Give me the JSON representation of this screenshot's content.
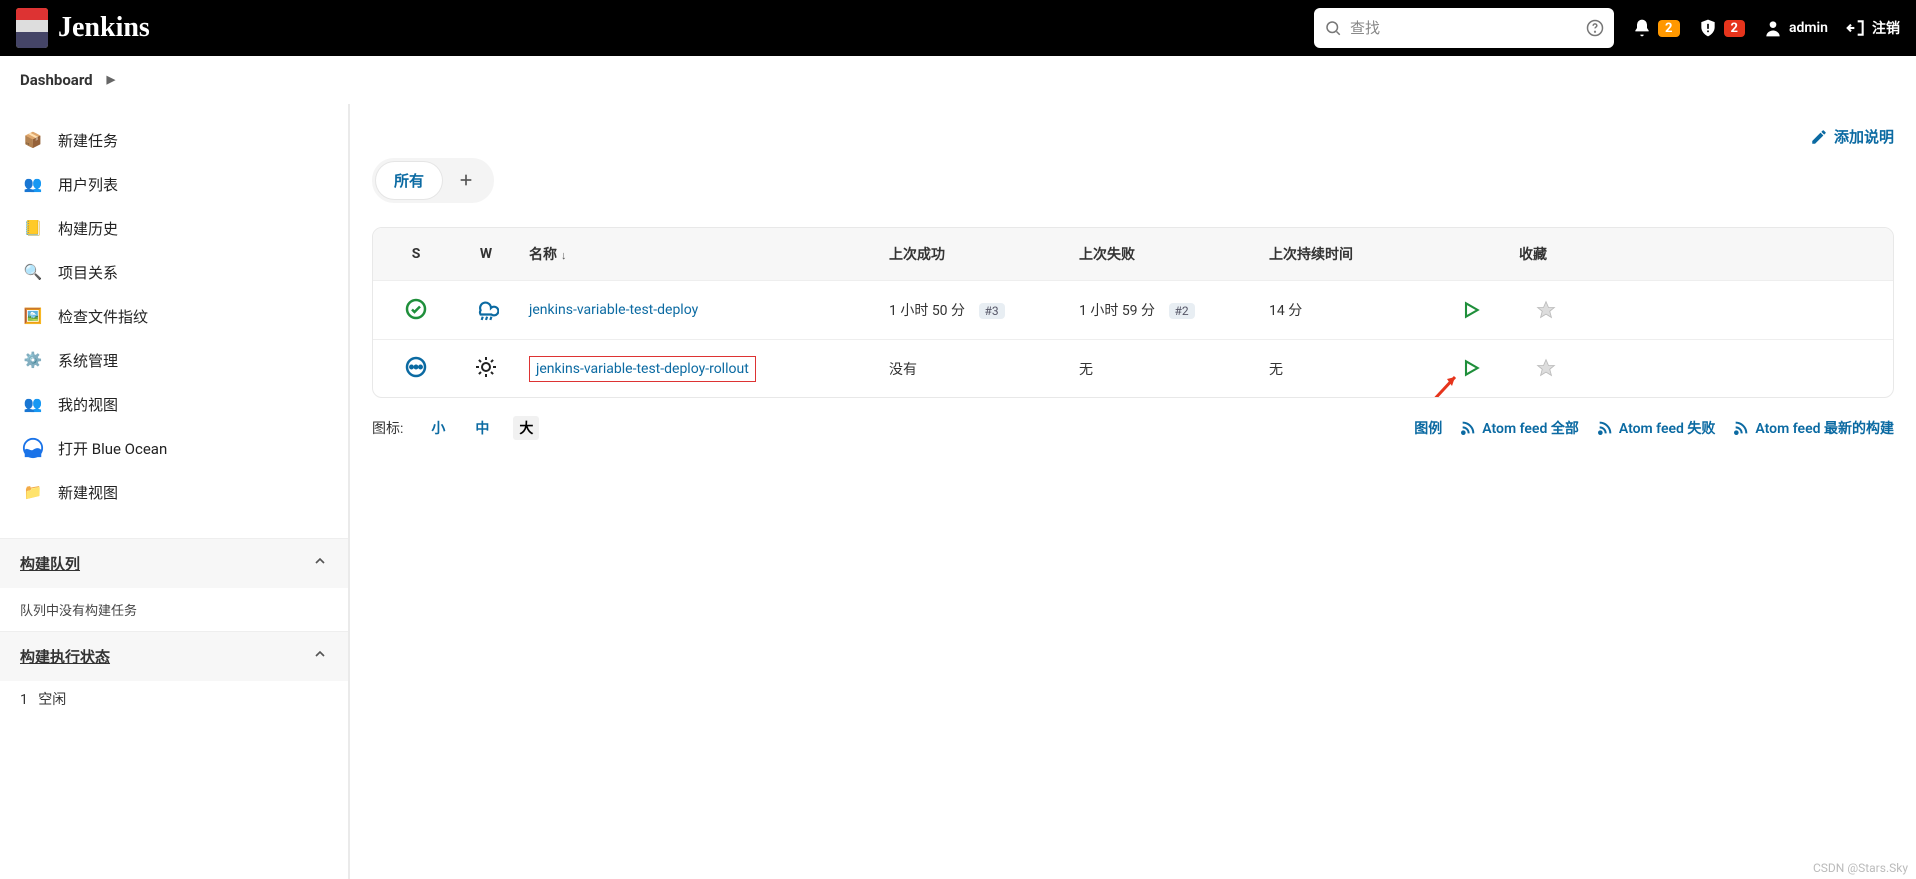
{
  "header": {
    "brand": "Jenkins",
    "search_placeholder": "查找",
    "notif_count": "2",
    "alert_count": "2",
    "username": "admin",
    "logout": "注销"
  },
  "breadcrumb": {
    "dashboard": "Dashboard"
  },
  "sidebar": {
    "items": [
      {
        "label": "新建任务"
      },
      {
        "label": "用户列表"
      },
      {
        "label": "构建历史"
      },
      {
        "label": "项目关系"
      },
      {
        "label": "检查文件指纹"
      },
      {
        "label": "系统管理"
      },
      {
        "label": "我的视图"
      },
      {
        "label": "打开 Blue Ocean"
      },
      {
        "label": "新建视图"
      }
    ],
    "queue_title": "构建队列",
    "queue_empty": "队列中没有构建任务",
    "exec_title": "构建执行状态",
    "exec_1_num": "1",
    "exec_1_state": "空闲"
  },
  "main": {
    "add_description": "添加说明",
    "tabs": {
      "all": "所有"
    },
    "columns": {
      "s": "S",
      "w": "W",
      "name": "名称",
      "last_success": "上次成功",
      "last_failure": "上次失败",
      "last_duration": "上次持续时间",
      "fav": "收藏"
    },
    "rows": [
      {
        "name": "jenkins-variable-test-deploy",
        "last_success": "1 小时 50 分",
        "last_success_build": "#3",
        "last_failure": "1 小时 59 分",
        "last_failure_build": "#2",
        "duration": "14 分",
        "status": "success",
        "weather": "rain",
        "highlight": false
      },
      {
        "name": "jenkins-variable-test-deploy-rollout",
        "last_success": "没有",
        "last_success_build": "",
        "last_failure": "无",
        "last_failure_build": "",
        "duration": "无",
        "status": "notbuilt",
        "weather": "unknown",
        "highlight": true
      }
    ],
    "footer": {
      "icons_label": "图标:",
      "size_small": "小",
      "size_medium": "中",
      "size_large": "大",
      "legend": "图例",
      "feed_all": "Atom feed 全部",
      "feed_fail": "Atom feed 失败",
      "feed_latest": "Atom feed 最新的构建"
    }
  },
  "watermark": "CSDN @Stars.Sky"
}
